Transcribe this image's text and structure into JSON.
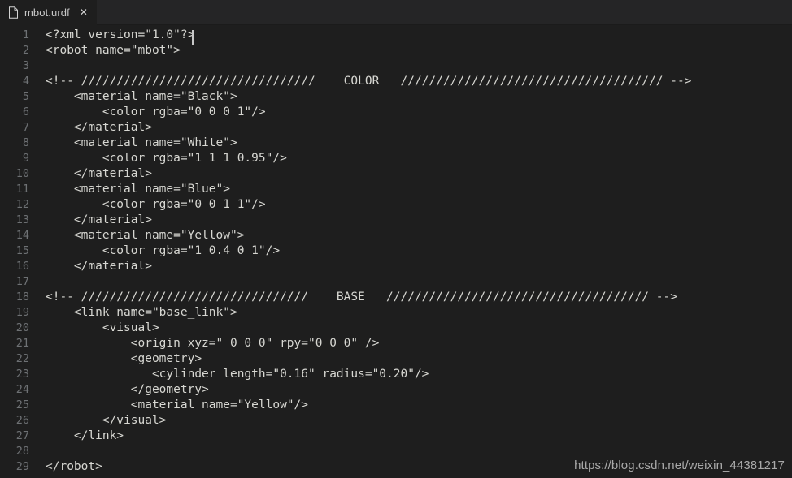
{
  "window": {
    "background_color": "#1e1e1e",
    "tabbar_color": "#252526",
    "text_color": "#d7d7d2",
    "linenumber_color": "#6e7174"
  },
  "tabbar": {
    "tabs": [
      {
        "label": "mbot.urdf",
        "file_icon": "file-icon",
        "close_icon": "close-icon",
        "close_label": "✕",
        "active": true
      }
    ]
  },
  "editor": {
    "language": "xml",
    "cursor": {
      "line": 1,
      "column": 22
    },
    "first_visible_line": 1,
    "last_visible_line": 29,
    "lines": [
      {
        "n": "1",
        "text": "<?xml version=\"1.0\"?>"
      },
      {
        "n": "2",
        "text": "<robot name=\"mbot\">"
      },
      {
        "n": "3",
        "text": ""
      },
      {
        "n": "4",
        "text": "<!-- /////////////////////////////////    COLOR   ///////////////////////////////////// -->"
      },
      {
        "n": "5",
        "text": "    <material name=\"Black\">"
      },
      {
        "n": "6",
        "text": "        <color rgba=\"0 0 0 1\"/>"
      },
      {
        "n": "7",
        "text": "    </material>"
      },
      {
        "n": "8",
        "text": "    <material name=\"White\">"
      },
      {
        "n": "9",
        "text": "        <color rgba=\"1 1 1 0.95\"/>"
      },
      {
        "n": "10",
        "text": "    </material>"
      },
      {
        "n": "11",
        "text": "    <material name=\"Blue\">"
      },
      {
        "n": "12",
        "text": "        <color rgba=\"0 0 1 1\"/>"
      },
      {
        "n": "13",
        "text": "    </material>"
      },
      {
        "n": "14",
        "text": "    <material name=\"Yellow\">"
      },
      {
        "n": "15",
        "text": "        <color rgba=\"1 0.4 0 1\"/>"
      },
      {
        "n": "16",
        "text": "    </material>"
      },
      {
        "n": "17",
        "text": ""
      },
      {
        "n": "18",
        "text": "<!-- ////////////////////////////////    BASE   ///////////////////////////////////// -->"
      },
      {
        "n": "19",
        "text": "    <link name=\"base_link\">"
      },
      {
        "n": "20",
        "text": "        <visual>"
      },
      {
        "n": "21",
        "text": "            <origin xyz=\" 0 0 0\" rpy=\"0 0 0\" />"
      },
      {
        "n": "22",
        "text": "            <geometry>"
      },
      {
        "n": "23",
        "text": "               <cylinder length=\"0.16\" radius=\"0.20\"/>"
      },
      {
        "n": "24",
        "text": "            </geometry>"
      },
      {
        "n": "25",
        "text": "            <material name=\"Yellow\"/>"
      },
      {
        "n": "26",
        "text": "        </visual>"
      },
      {
        "n": "27",
        "text": "    </link>"
      },
      {
        "n": "28",
        "text": ""
      },
      {
        "n": "29",
        "text": "</robot>"
      }
    ]
  },
  "watermark": {
    "text": "https://blog.csdn.net/weixin_44381217"
  }
}
